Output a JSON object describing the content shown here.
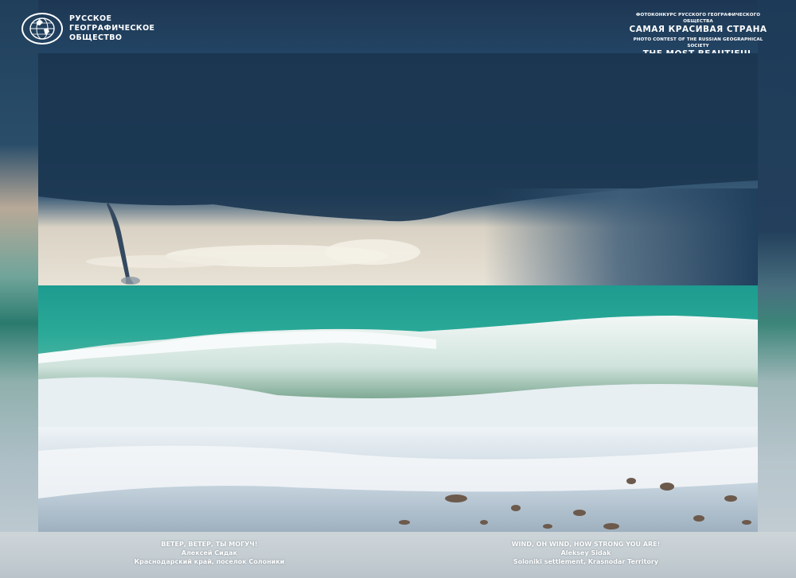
{
  "header": {
    "org_lines": [
      "РУССКОЕ",
      "ГЕОГРАФИЧЕСКОЕ",
      "ОБЩЕСТВО"
    ],
    "contest_ru_small": "ФОТОКОНКУРС РУССКОГО ГЕОГРАФИЧЕСКОГО ОБЩЕСТВА",
    "contest_ru_big": "САМАЯ КРАСИВАЯ СТРАНА",
    "contest_en_small": "PHOTO CONTEST OF THE RUSSIAN GEOGRAPHICAL SOCIETY",
    "contest_en_big": "THE MOST BEAUTIFUL COUNTRY"
  },
  "photo": {
    "subject": "waterspout over sea with breaking wave on pebble beach"
  },
  "caption_ru": {
    "title": "ВЕТЕР, ВЕТЕР, ТЫ МОГУЧ!",
    "author": "Алексей Сидак",
    "location": "Краснодарский край, поселок Солоники"
  },
  "caption_en": {
    "title": "WIND, OH WIND, HOW STRONG YOU ARE!",
    "author": "Aleksey Sidak",
    "location": "Soloniki settlement, Krasnodar Territory"
  }
}
